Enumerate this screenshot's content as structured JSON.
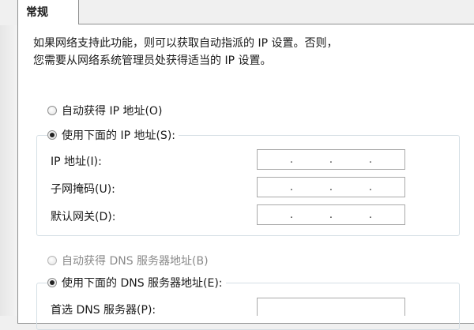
{
  "tabs": [
    {
      "label": "常规"
    }
  ],
  "description": {
    "line1": "如果网络支持此功能，则可以获取自动指派的 IP 设置。否则，",
    "line2": "您需要从网络系统管理员处获得适当的 IP 设置。"
  },
  "ip_section": {
    "auto_label": "自动获得 IP 地址(O)",
    "manual_label": "使用下面的 IP 地址(S):",
    "selected": "manual",
    "fields": [
      {
        "label": "IP 地址(I):",
        "value": ""
      },
      {
        "label": "子网掩码(U):",
        "value": ""
      },
      {
        "label": "默认网关(D):",
        "value": ""
      }
    ]
  },
  "dns_section": {
    "auto_label": "自动获得 DNS 服务器地址(B)",
    "manual_label": "使用下面的 DNS 服务器地址(E):",
    "selected": "manual",
    "auto_disabled": true,
    "fields": [
      {
        "label": "首选 DNS 服务器(P):",
        "value": ""
      }
    ]
  },
  "ip_separator": "."
}
